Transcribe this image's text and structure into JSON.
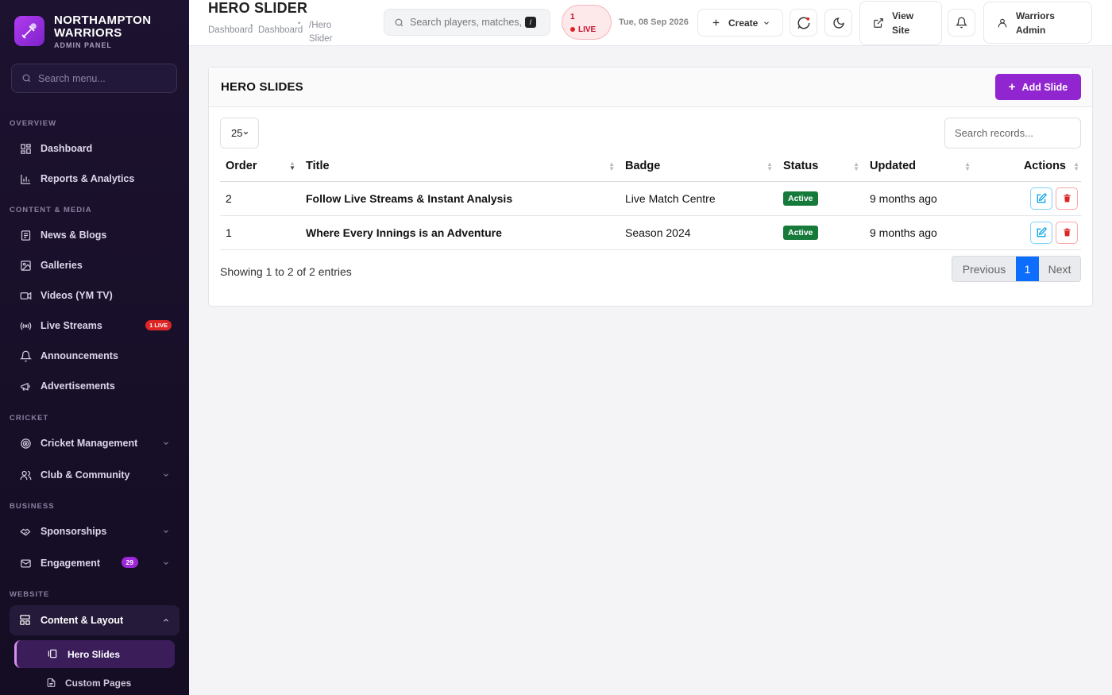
{
  "brand": {
    "name": "NORTHAMPTON WARRIORS",
    "sub": "ADMIN PANEL"
  },
  "sidebar": {
    "search_placeholder": "Search menu...",
    "sections": {
      "overview": "OVERVIEW",
      "content": "CONTENT & MEDIA",
      "cricket": "CRICKET",
      "business": "BUSINESS",
      "website": "WEBSITE"
    },
    "items": {
      "dashboard": "Dashboard",
      "reports": "Reports & Analytics",
      "news": "News & Blogs",
      "galleries": "Galleries",
      "videos": "Videos (YM TV)",
      "live": "Live Streams",
      "live_badge": "1 LIVE",
      "announcements": "Announcements",
      "ads": "Advertisements",
      "cricket_mgmt": "Cricket Management",
      "club": "Club & Community",
      "sponsorships": "Sponsorships",
      "engagement": "Engagement",
      "engagement_badge": "29",
      "content_layout": "Content & Layout",
      "hero_slides": "Hero Slides",
      "custom_pages": "Custom Pages"
    }
  },
  "header": {
    "title": "HERO SLIDER",
    "breadcrumbs": [
      "Dashboard",
      "Dashboard",
      "/Hero Slider"
    ],
    "search_placeholder": "Search players, matches, news...",
    "kbd": "/",
    "live_count": "1",
    "live_label": "LIVE",
    "date": "Tue, 08 Sep 2026",
    "create_label": "Create",
    "view_site_label": "View Site",
    "user_label": "Warriors Admin"
  },
  "card": {
    "title": "HERO SLIDES",
    "add_label": "Add Slide",
    "page_size": "25",
    "search_placeholder": "Search records...",
    "columns": {
      "order": "Order",
      "title": "Title",
      "badge": "Badge",
      "status": "Status",
      "updated": "Updated",
      "actions": "Actions"
    },
    "rows": [
      {
        "order": "2",
        "title": "Follow Live Streams & Instant Analysis",
        "badge": "Live Match Centre",
        "status": "Active",
        "updated": "9 months ago"
      },
      {
        "order": "1",
        "title": "Where Every Innings is an Adventure",
        "badge": "Season 2024",
        "status": "Active",
        "updated": "9 months ago"
      }
    ],
    "info": "Showing 1 to 2 of 2 entries",
    "pager": {
      "prev": "Previous",
      "current": "1",
      "next": "Next"
    }
  },
  "colors": {
    "accent": "#9125d0",
    "status_active": "#167a3b",
    "live_red": "#dc2626",
    "page_active": "#0d6efd"
  }
}
